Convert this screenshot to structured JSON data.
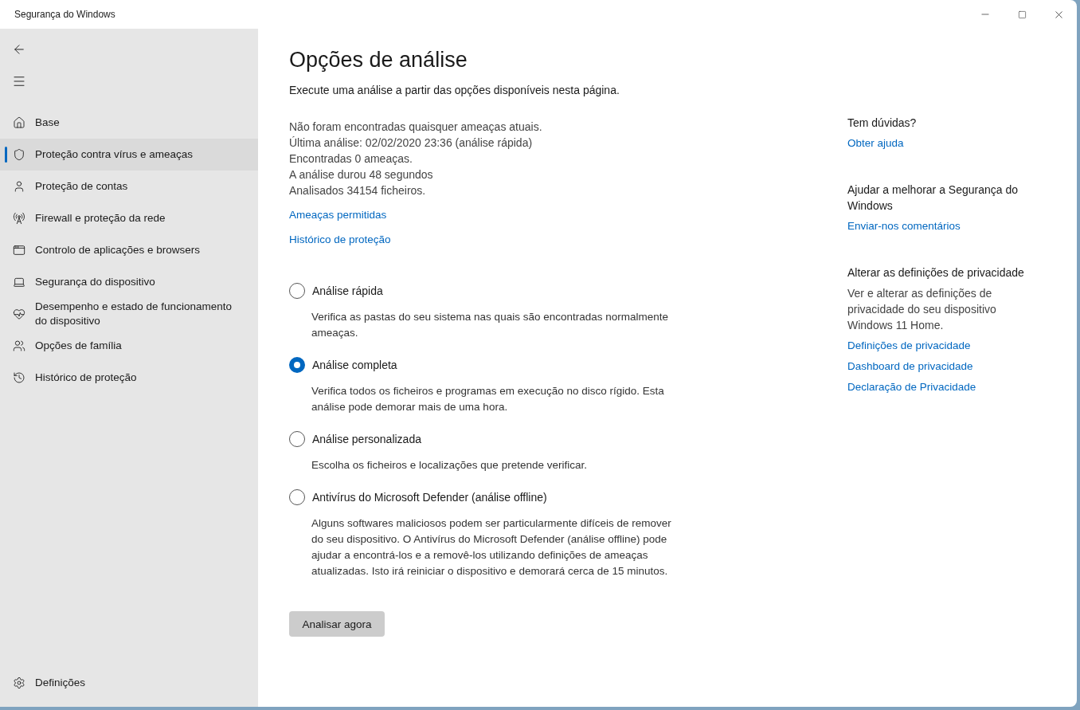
{
  "window": {
    "title": "Segurança do Windows"
  },
  "sidebar": {
    "items": [
      {
        "label": "Base",
        "selected": false
      },
      {
        "label": "Proteção contra vírus e ameaças",
        "selected": true
      },
      {
        "label": "Proteção de contas",
        "selected": false
      },
      {
        "label": "Firewall e proteção da rede",
        "selected": false
      },
      {
        "label": "Controlo de aplicações e browsers",
        "selected": false
      },
      {
        "label": "Segurança do dispositivo",
        "selected": false
      },
      {
        "label": "Desempenho e estado de funcionamento do dispositivo",
        "selected": false
      },
      {
        "label": "Opções de família",
        "selected": false
      },
      {
        "label": "Histórico de proteção",
        "selected": false
      }
    ],
    "settings": "Definições"
  },
  "main": {
    "title": "Opções de análise",
    "subtitle": "Execute uma análise a partir das opções disponíveis nesta página.",
    "status": [
      "Não foram encontradas quaisquer ameaças atuais.",
      "Última análise: 02/02/2020 23:36 (análise rápida)",
      "Encontradas 0 ameaças.",
      "A análise durou 48 segundos",
      "Analisados 34154 ficheiros."
    ],
    "links": [
      "Ameaças permitidas",
      "Histórico de proteção"
    ],
    "options": [
      {
        "label": "Análise rápida",
        "description": "Verifica as pastas do seu sistema nas quais são encontradas normalmente ameaças.",
        "selected": false
      },
      {
        "label": "Análise completa",
        "description": "Verifica todos os ficheiros e programas em execução no disco rígido. Esta análise pode demorar mais de uma hora.",
        "selected": true
      },
      {
        "label": "Análise personalizada",
        "description": "Escolha os ficheiros e localizações que pretende verificar.",
        "selected": false
      },
      {
        "label": "Antivírus do Microsoft Defender (análise offline)",
        "description": "Alguns softwares maliciosos podem ser particularmente difíceis de remover do seu dispositivo. O Antivírus do Microsoft Defender (análise offline) pode ajudar a encontrá-los e a removê-los utilizando definições de ameaças atualizadas. Isto irá reiniciar o dispositivo e demorará cerca de 15 minutos.",
        "selected": false
      }
    ],
    "scan_button": "Analisar agora"
  },
  "aside": [
    {
      "heading": "Tem dúvidas?",
      "links": [
        "Obter ajuda"
      ]
    },
    {
      "heading": "Ajudar a melhorar a Segurança do Windows",
      "links": [
        "Enviar-nos comentários"
      ]
    },
    {
      "heading": "Alterar as definições de privacidade",
      "text": "Ver e alterar as definições de privacidade do seu dispositivo Windows 11 Home.",
      "links": [
        "Definições de privacidade",
        "Dashboard de privacidade",
        "Declaração de Privacidade"
      ]
    }
  ]
}
